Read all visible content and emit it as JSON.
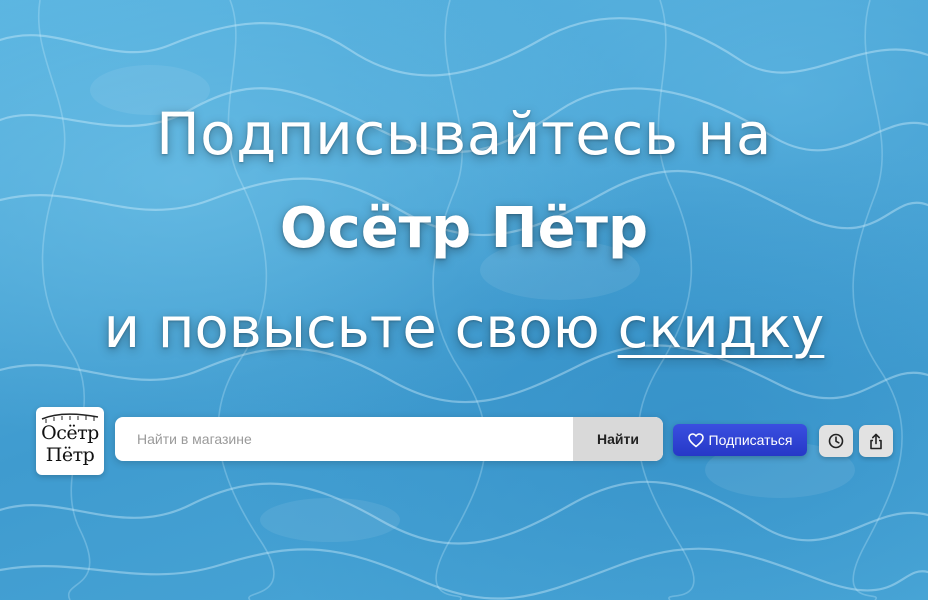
{
  "banner": {
    "line1": "Подписывайтесь на",
    "line2": "Осётр Пётр",
    "line3_prefix": "и повысьте свою ",
    "line3_emphasis": "скидку"
  },
  "logo": {
    "line1": "Осётр",
    "line2": "Пётр"
  },
  "search": {
    "placeholder": "Найти в магазине",
    "button_label": "Найти"
  },
  "subscribe": {
    "label": "Подписаться",
    "icon": "heart-icon"
  },
  "actions": {
    "history_icon": "clock-icon",
    "share_icon": "share-icon"
  },
  "colors": {
    "background": "#4aa6d6",
    "subscribe": "#2f44d4",
    "search_button": "#d9d9d9"
  }
}
